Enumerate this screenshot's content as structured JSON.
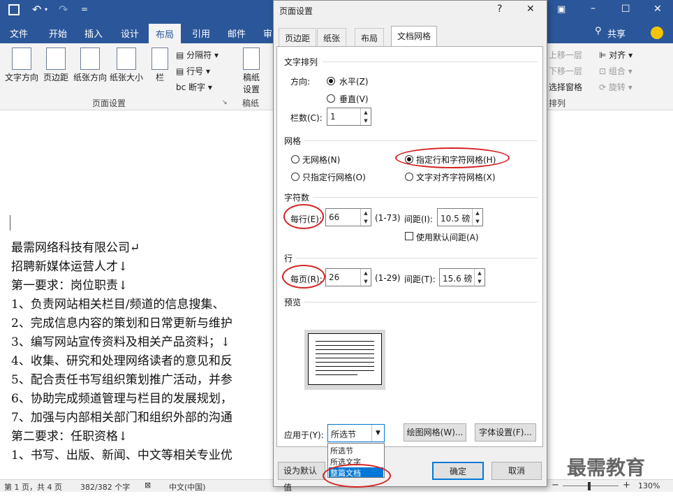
{
  "app": {
    "quick_access": {
      "save_icon": "save-icon",
      "undo_icon": "undo-icon",
      "redo_icon": "redo-icon",
      "customize": "="
    },
    "window_controls": {
      "minimize": "–",
      "restore": "☐",
      "close": "✕",
      "ribbon_opts": "▣"
    },
    "tabs": [
      "文件",
      "开始",
      "插入",
      "设计",
      "布局",
      "引用",
      "邮件",
      "审"
    ],
    "active_tab": "布局",
    "share": "共享",
    "ribbon": {
      "buttons": [
        "文字方向",
        "页边距",
        "纸张方向",
        "纸张大小",
        "栏"
      ],
      "small": [
        "分隔符",
        "行号",
        "断字"
      ],
      "manuscript": [
        "稿纸",
        "设置"
      ],
      "group_page_setup": "页面设置",
      "group_manuscript": "稿纸",
      "right_items": [
        "上移一层",
        "下移一层",
        "选择窗格",
        "对齐",
        "组合",
        "旋转"
      ],
      "group_arrange": "排列"
    },
    "document_lines": [
      "最需网络科技有限公司↵",
      "招聘新媒体运营人才↓",
      "第一要求：岗位职责↓",
      "1、负责网站相关栏目/频道的信息搜集、",
      "2、完成信息内容的策划和日常更新与维护",
      "3、编写网站宣传资料及相关产品资料；↓",
      "4、收集、研究和处理网络读者的意见和反",
      "5、配合责任书写组织策划推广活动，并参",
      "6、协助完成频道管理与栏目的发展规划，",
      "7、加强与内部相关部门和组织外部的沟通",
      "第二要求：任职资格↓",
      "1、书写、出版、新闻、中文等相关专业优"
    ],
    "status": {
      "page": "第 1 页，共 4 页",
      "words": "382/382 个字",
      "lang": "中文(中国)",
      "minus": "−",
      "plus": "+",
      "zoom": "130%"
    }
  },
  "dialog": {
    "title": "页面设置",
    "help": "?",
    "close": "✕",
    "tabs": [
      "页边距",
      "纸张",
      "布局",
      "文档网格"
    ],
    "active_tab": "文档网格",
    "text_layout": {
      "section": "文字排列",
      "direction_label": "方向:",
      "horizontal": "水平(Z)",
      "vertical": "垂直(V)",
      "columns_label": "栏数(C):",
      "columns_value": "1"
    },
    "grid": {
      "section": "网格",
      "no_grid": "无网格(N)",
      "line_char_grid": "指定行和字符网格(H)",
      "line_grid_only": "只指定行网格(O)",
      "text_snap_char": "文字对齐字符网格(X)",
      "selected": "指定行和字符网格(H)"
    },
    "characters": {
      "section": "字符数",
      "per_line_label": "每行(E):",
      "per_line_value": "66",
      "per_line_range": "(1-73)",
      "pitch_label": "间距(I):",
      "pitch_value": "10.5 磅",
      "use_default": "使用默认间距(A)"
    },
    "lines": {
      "section": "行",
      "per_page_label": "每页(R):",
      "per_page_value": "26",
      "per_page_range": "(1-29)",
      "pitch_label": "间距(T):",
      "pitch_value": "15.6 磅"
    },
    "preview": {
      "section": "预览"
    },
    "apply": {
      "label": "应用于(Y):",
      "selected": "所选节",
      "options": [
        "所选节",
        "所选文字",
        "整篇文档"
      ],
      "highlighted": "整篇文档"
    },
    "draw_grid": "绘图网格(W)...",
    "font_settings": "字体设置(F)...",
    "set_default": "设为默认值",
    "ok": "确定",
    "cancel": "取消"
  },
  "watermark": "最需教育",
  "colors": {
    "ribbon_blue": "#2b579a",
    "annotation_red": "#d42222",
    "highlight_blue": "#0078d7"
  }
}
